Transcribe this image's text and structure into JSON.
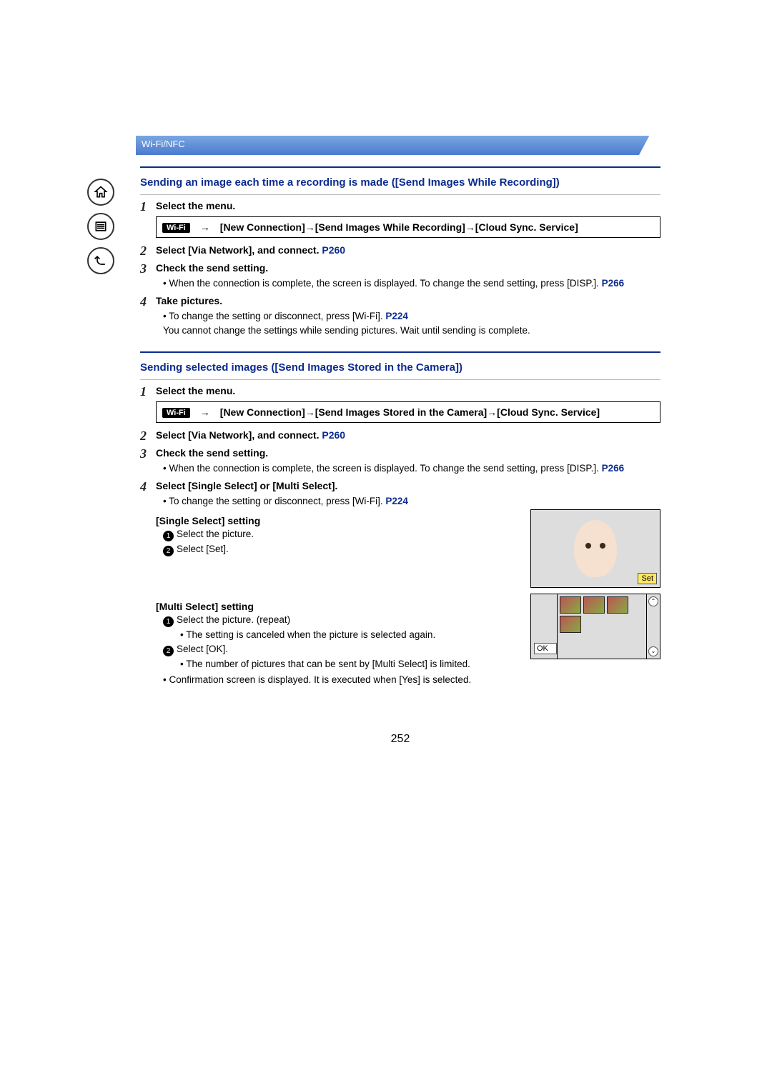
{
  "header": {
    "section": "Wi-Fi/NFC"
  },
  "badge": {
    "wifi": "Wi-Fi"
  },
  "section_a": {
    "title": "Sending an image each time a recording is made ([Send Images While Recording])",
    "steps": {
      "s1": {
        "num": "1",
        "text": "Select the menu."
      },
      "s1_path": "[New Connection]→[Send Images While Recording]→[Cloud Sync. Service]",
      "s2": {
        "num": "2",
        "text_a": "Select [Via Network], and connect. ",
        "link": "P260"
      },
      "s3": {
        "num": "3",
        "text": "Check the send setting.",
        "bul1": "When the connection is complete, the screen is displayed. To change the send setting, press [DISP.]. ",
        "bul1_link": "P266"
      },
      "s4": {
        "num": "4",
        "text": "Take pictures.",
        "bul1": "To change the setting or disconnect, press [Wi-Fi]. ",
        "bul1_link": "P224",
        "note": "You cannot change the settings while sending pictures. Wait until sending is complete."
      }
    }
  },
  "section_b": {
    "title": "Sending selected images ([Send Images Stored in the Camera])",
    "steps": {
      "s1": {
        "num": "1",
        "text": "Select the menu."
      },
      "s1_path": "[New Connection]→[Send Images Stored in the Camera]→[Cloud Sync. Service]",
      "s2": {
        "num": "2",
        "text_a": "Select [Via Network], and connect. ",
        "link": "P260"
      },
      "s3": {
        "num": "3",
        "text": "Check the send setting.",
        "bul1": "When the connection is complete, the screen is displayed. To change the send setting, press [DISP.]. ",
        "bul1_link": "P266"
      },
      "s4": {
        "num": "4",
        "text": "Select [Single Select] or [Multi Select].",
        "bul1": "To change the setting or disconnect, press [Wi-Fi]. ",
        "bul1_link": "P224"
      }
    },
    "single": {
      "heading": "[Single Select] setting",
      "i1": "Select the picture.",
      "i2": "Select [Set].",
      "set_label": "Set"
    },
    "multi": {
      "heading": "[Multi Select] setting",
      "i1": "Select the picture. (repeat)",
      "i1_sub": "The setting is canceled when the picture is selected again.",
      "i2": "Select [OK].",
      "i2_sub": "The number of pictures that can be sent by [Multi Select] is limited.",
      "ok_label": "OK"
    },
    "confirm": "Confirmation screen is displayed. It is executed when [Yes] is selected."
  },
  "page_number": "252"
}
